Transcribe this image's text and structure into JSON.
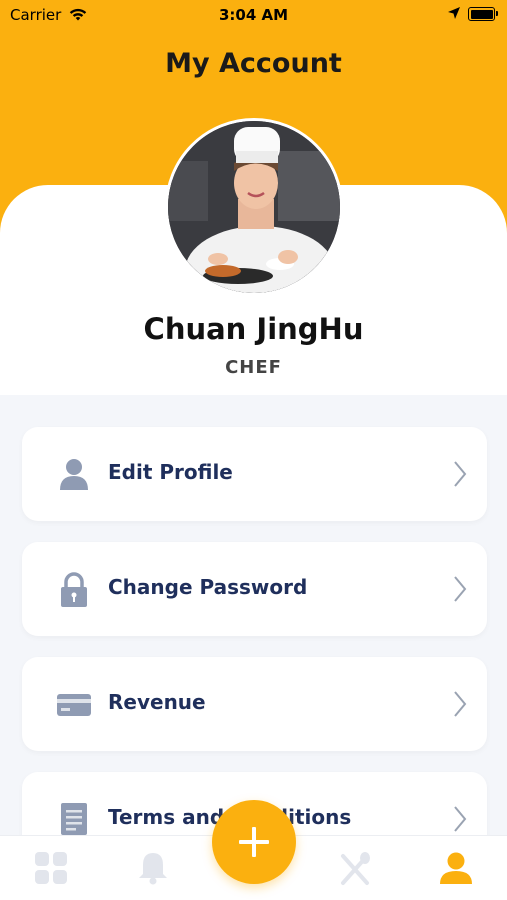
{
  "status_bar": {
    "carrier": "Carrier",
    "time": "3:04 AM"
  },
  "header": {
    "title": "My Account",
    "background_color": "#fbb00f"
  },
  "profile": {
    "name": "Chuan JingHu",
    "role": "CHEF",
    "avatar_icon": "chef-photo"
  },
  "menu": {
    "items": [
      {
        "label": "Edit Profile",
        "icon": "user-icon"
      },
      {
        "label": "Change Password",
        "icon": "lock-icon"
      },
      {
        "label": "Revenue",
        "icon": "card-icon"
      },
      {
        "label": "Terms and Conditions",
        "icon": "document-icon"
      }
    ]
  },
  "tab_bar": {
    "tabs": [
      {
        "icon": "dashboard-icon",
        "active": false
      },
      {
        "icon": "bell-icon",
        "active": false
      },
      {
        "icon": "add-icon",
        "active": false
      },
      {
        "icon": "utensils-icon",
        "active": false
      },
      {
        "icon": "account-icon",
        "active": true
      }
    ],
    "active_color": "#fbb00f",
    "inactive_color": "#e2e5ec"
  },
  "colors": {
    "accent": "#fbb00f",
    "label": "#1f2f5c",
    "icon": "#8f9bb3"
  }
}
